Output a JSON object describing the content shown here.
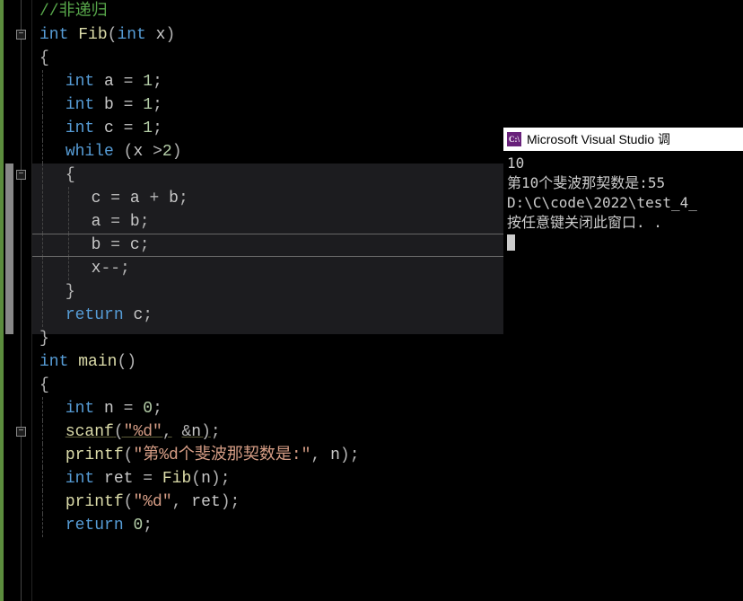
{
  "code": {
    "l0": "//非递归",
    "l1_int": "int",
    "l1_func": "Fib",
    "l1_lp": "(",
    "l1_param_t": "int",
    "l1_param_n": "x",
    "l1_rp": ")",
    "l2_brace": "{",
    "l3_t": "int",
    "l3_v": "a",
    "l3_eq": "=",
    "l3_n": "1",
    "l3_s": ";",
    "l4_t": "int",
    "l4_v": "b",
    "l4_eq": "=",
    "l4_n": "1",
    "l4_s": ";",
    "l5_t": "int",
    "l5_v": "c",
    "l5_eq": "=",
    "l5_n": "1",
    "l5_s": ";",
    "l6_kw": "while",
    "l6_lp": "(",
    "l6_v": "x",
    "l6_op": ">",
    "l6_n": "2",
    "l6_rp": ")",
    "l7_brace": "{",
    "l8_v1": "c",
    "l8_eq": "=",
    "l8_v2": "a",
    "l8_plus": "+",
    "l8_v3": "b",
    "l8_s": ";",
    "l9_v1": "a",
    "l9_eq": "=",
    "l9_v2": "b",
    "l9_s": ";",
    "l10_v1": "b",
    "l10_eq": "=",
    "l10_v2": "c",
    "l10_s": ";",
    "l11_v": "x",
    "l11_op": "--",
    "l11_s": ";",
    "l12_brace": "}",
    "l13_kw": "return",
    "l13_v": "c",
    "l13_s": ";",
    "l14_brace": "}",
    "l15_int": "int",
    "l15_func": "main",
    "l15_lp": "(",
    "l15_rp": ")",
    "l16_brace": "{",
    "l17_t": "int",
    "l17_v": "n",
    "l17_eq": "=",
    "l17_n": "0",
    "l17_s": ";",
    "l18_func": "scanf",
    "l18_lp": "(",
    "l18_str": "\"%d\"",
    "l18_c": ",",
    "l18_amp": "&",
    "l18_v": "n",
    "l18_rp": ")",
    "l18_s": ";",
    "l19_func": "printf",
    "l19_lp": "(",
    "l19_str": "\"第%d个斐波那契数是:\"",
    "l19_c": ",",
    "l19_v": "n",
    "l19_rp": ")",
    "l19_s": ";",
    "l20_t": "int",
    "l20_v": "ret",
    "l20_eq": "=",
    "l20_func": "Fib",
    "l20_lp": "(",
    "l20_arg": "n",
    "l20_rp": ")",
    "l20_s": ";",
    "l21_func": "printf",
    "l21_lp": "(",
    "l21_str": "\"%d\"",
    "l21_c": ",",
    "l21_v": "ret",
    "l21_rp": ")",
    "l21_s": ";",
    "l22_kw": "return",
    "l22_n": "0",
    "l22_s": ";"
  },
  "console": {
    "icon": "C:\\",
    "title": "Microsoft Visual Studio 调",
    "line1": "10",
    "line2": "第10个斐波那契数是:55",
    "line3": "D:\\C\\code\\2022\\test_4_",
    "line4": "按任意键关闭此窗口. ."
  },
  "fold": {
    "minus": "−"
  }
}
